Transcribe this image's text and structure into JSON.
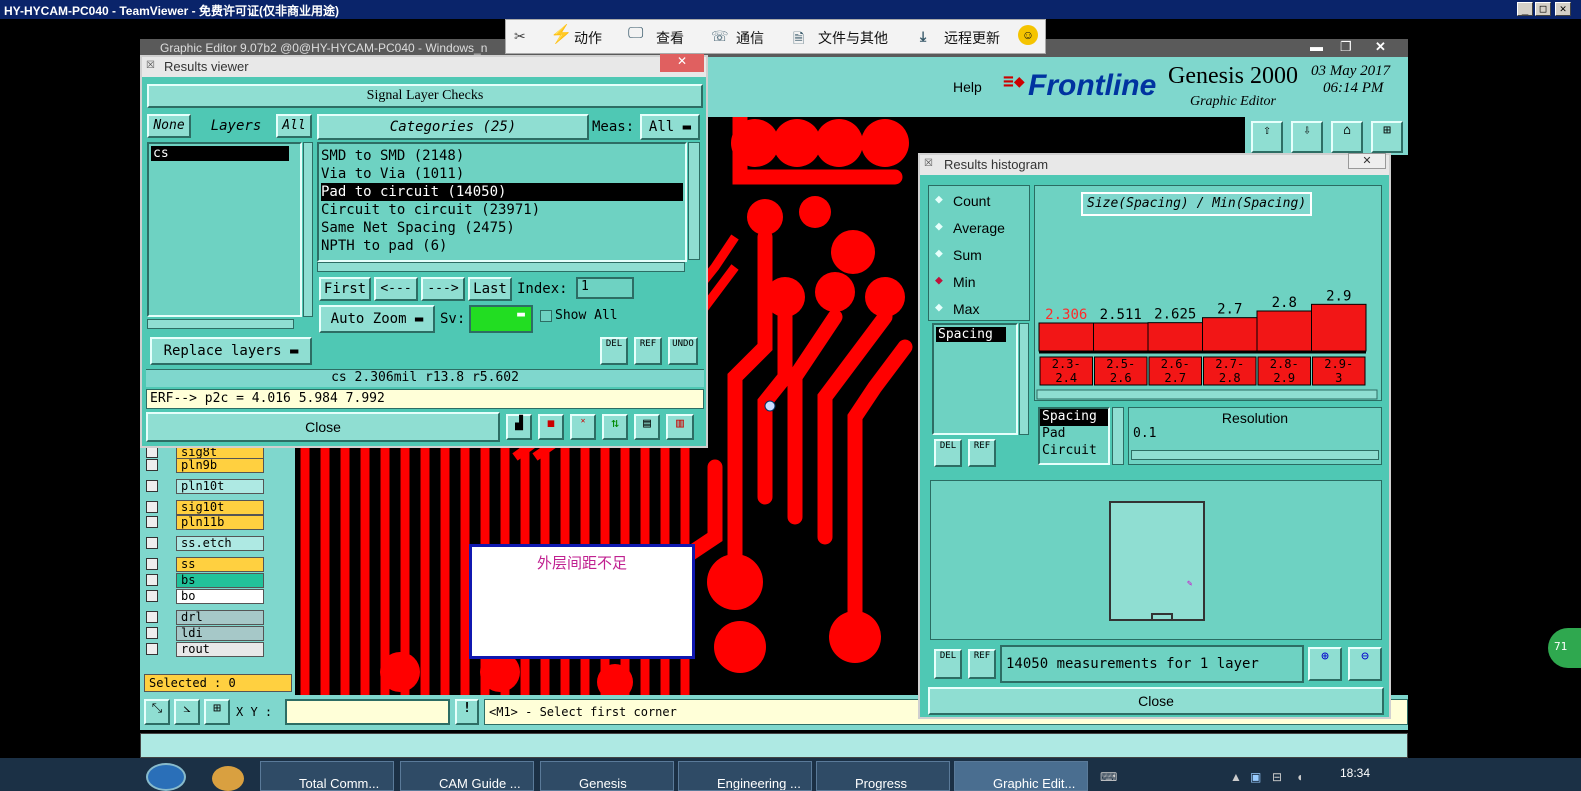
{
  "teamviewer": {
    "title": "HY-HYCAM-PC040 - TeamViewer - 免费许可证(仅非商业用途)",
    "toolbar": {
      "actions": "动作",
      "view": "查看",
      "comm": "通信",
      "files": "文件与其他",
      "update": "远程更新"
    }
  },
  "ge": {
    "title": "Graphic Editor 9.07b2 @0@HY-HYCAM-PC040 - Windows_n",
    "help": "Help",
    "brand": "Frontline",
    "product": "Genesis 2000",
    "subtitle": "Graphic Editor",
    "date": "03 May 2017",
    "time": "06:14 PM"
  },
  "results_viewer": {
    "title": "Results viewer",
    "header": "Signal Layer Checks",
    "none": "None",
    "layers": "Layers",
    "all": "All",
    "layer_items": [
      "cs"
    ],
    "categories": "Categories (25)",
    "meas_label": "Meas:",
    "meas_value": "All",
    "checks": [
      "SMD to SMD (2148)",
      "Via to Via (1011)",
      "Pad to circuit (14050)",
      "Circuit to circuit (23971)",
      "Same Net Spacing (2475)",
      "NPTH to pad (6)"
    ],
    "first": "First",
    "prev": "<---",
    "next": "--->",
    "last": "Last",
    "index_label": "Index:",
    "index_value": "1",
    "auto_zoom": "Auto Zoom",
    "sv_label": "Sv:",
    "show_all": "Show All",
    "replace_layers": "Replace layers",
    "del": "DEL",
    "ref": "REF",
    "undo": "UNDO",
    "info": "cs 2.306mil  r13.8  r5.602",
    "erf": "ERF--> p2c = 4.016 5.984 7.992",
    "close": "Close"
  },
  "histogram": {
    "title": "Results histogram",
    "modes": [
      "Count",
      "Average",
      "Sum",
      "Min",
      "Max"
    ],
    "selected_mode": "Min",
    "chart_title": "Size(Spacing) / Min(Spacing)",
    "list1": [
      "Spacing"
    ],
    "list2": [
      "Spacing",
      "Pad",
      "Circuit"
    ],
    "resolution_label": "Resolution",
    "resolution_value": "0.1",
    "status": "14050 measurements for 1 layer",
    "close": "Close",
    "del": "DEL",
    "ref": "REF"
  },
  "chart_data": {
    "type": "bar",
    "title": "Size(Spacing) / Min(Spacing)",
    "categories": [
      "2.3-2.4",
      "2.5-2.6",
      "2.6-2.7",
      "2.7-2.8",
      "2.8-2.9",
      "2.9-3"
    ],
    "values": [
      2.306,
      2.511,
      2.625,
      2.7,
      2.8,
      2.9
    ],
    "value_labels": [
      "2.306",
      "2.511",
      "2.625",
      "2.7",
      "2.8",
      "2.9"
    ],
    "colors": {
      "bar": "#f21616",
      "first_label": "#ff2a2a"
    }
  },
  "layers_panel": {
    "items": [
      "sig8t",
      "pln9b",
      "pln10t",
      "sig10t",
      "pln11b",
      "ss.etch",
      "ss",
      "bs",
      "bo",
      "drl",
      "ldi",
      "rout"
    ],
    "selected": "Selected : 0"
  },
  "status": {
    "xy_label": "X Y :",
    "prompt": "<M1> - Select first corner"
  },
  "note": {
    "text": "外层间距不足"
  },
  "taskbar": {
    "items": [
      "Total Comm...",
      "CAM Guide ...",
      "Genesis",
      "Engineering ...",
      "Progress",
      "Graphic Edit..."
    ],
    "time": "18:34"
  }
}
